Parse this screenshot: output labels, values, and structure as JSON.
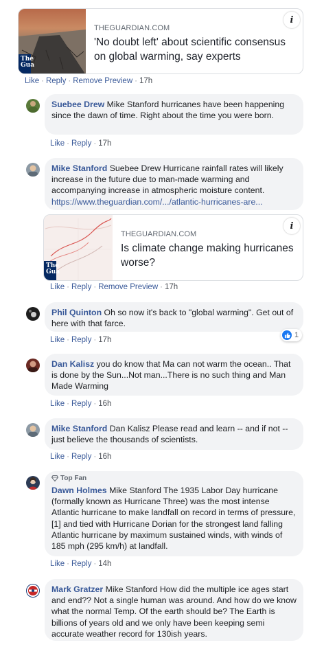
{
  "post_actions": {
    "like": "Like",
    "reply": "Reply",
    "remove_preview": "Remove Preview",
    "time": "17h"
  },
  "link_card_1": {
    "domain": "THEGUARDIAN.COM",
    "title": "'No doubt left' about scientific consensus on global warming, say experts",
    "logo": "The Gua"
  },
  "comments": [
    {
      "author": "Suebee Drew",
      "text": "Mike Stanford hurricanes have been happening since the dawn of time. Right about the time you were born.",
      "like": "Like",
      "reply": "Reply",
      "time": "17h"
    },
    {
      "author": "Mike Stanford",
      "text": "Suebee Drew Hurricane rainfall rates will likely increase in the future due to man-made warming and accompanying increase in atmospheric moisture content.",
      "url": "https://www.theguardian.com/.../atlantic-hurricanes-are...",
      "like": "Like",
      "reply": "Reply",
      "remove_preview": "Remove Preview",
      "time": "17h",
      "link_card": {
        "domain": "THEGUARDIAN.COM",
        "title": "Is climate change making hurricanes worse?",
        "logo": "The Gua"
      }
    },
    {
      "author": "Phil Quinton",
      "text": "Oh so now it's back to \"global warming\". Get out of here with that farce.",
      "like": "Like",
      "reply": "Reply",
      "time": "17h",
      "reaction_count": "1"
    },
    {
      "author": "Dan Kalisz",
      "text": "you do know that Ma can not warm the ocean.. That is done by the Sun...Not man...There is no such thing and Man Made Warming",
      "like": "Like",
      "reply": "Reply",
      "time": "16h"
    },
    {
      "author": "Mike Stanford",
      "text": "Dan Kalisz Please read and learn -- and if not -- just believe the thousands of scientists.",
      "like": "Like",
      "reply": "Reply",
      "time": "16h"
    },
    {
      "badge": "Top Fan",
      "author": "Dawn Holmes",
      "text": "Mike Stanford The 1935 Labor Day hurricane (formally known as Hurricane Three) was the most intense Atlantic hurricane to make landfall on record in terms of pressure,[1] and tied with Hurricane Dorian for the strongest land falling Atlantic hurricane by maximum sustained winds, with winds of 185 mph (295 km/h) at landfall.",
      "like": "Like",
      "reply": "Reply",
      "time": "14h"
    },
    {
      "author": "Mark Gratzer",
      "text": "Mike Stanford How did the multiple ice ages start and end?? Not a single human was around. And how do we know what the normal Temp. Of the earth should be? The Earth is billions of years old and we only have been keeping semi accurate weather record for 130ish years."
    }
  ],
  "colors": {
    "link": "#385898",
    "bubble": "#f2f3f5",
    "meta": "#606770",
    "like_badge": "#1877f2"
  }
}
